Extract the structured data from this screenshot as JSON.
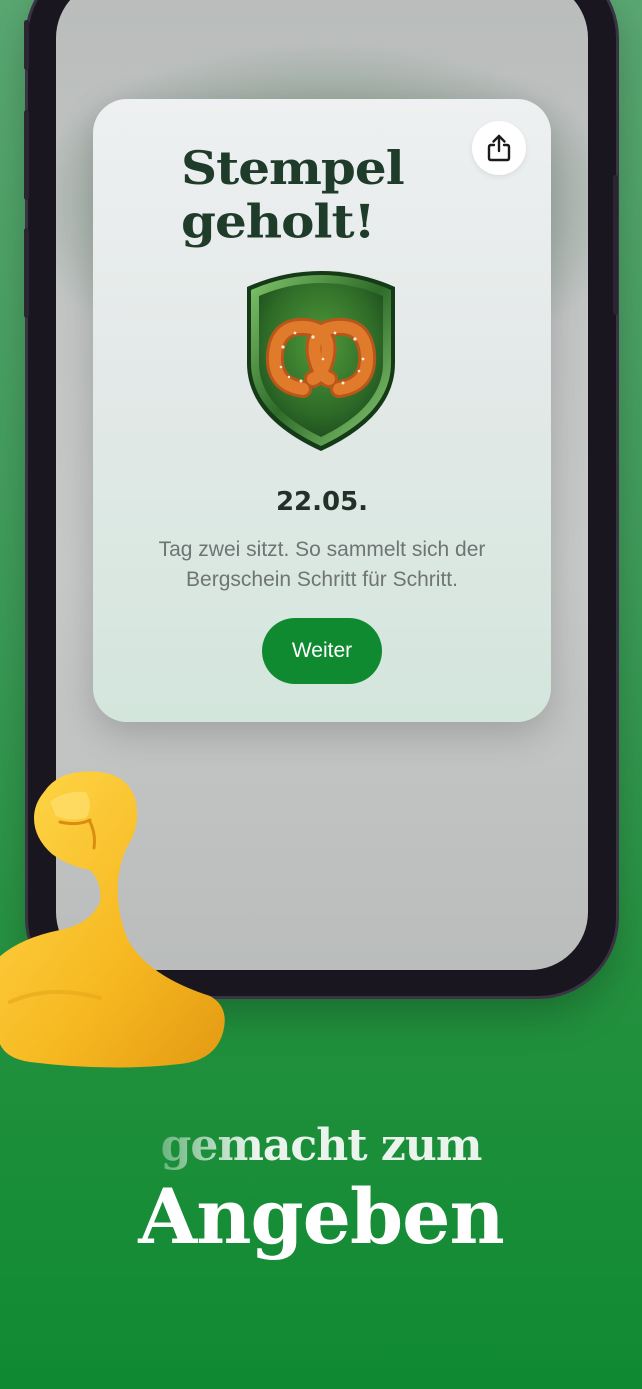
{
  "card": {
    "title_line1": "Stempel",
    "title_line2": "geholt!",
    "badge_icon": "pretzel-badge-icon",
    "date": "22.05.",
    "description": "Tag zwei sitzt. So sammelt sich der Bergschein Schritt für Schritt.",
    "continue_label": "Weiter",
    "share_icon": "share-icon"
  },
  "promo": {
    "tagline_faded": "gem",
    "tagline_rest": "acht zum",
    "headline": "Angeben",
    "emoji": "flexed-biceps-icon"
  },
  "colors": {
    "background": "#24913f",
    "button": "#0f8a30",
    "title": "#1f3b2a"
  }
}
